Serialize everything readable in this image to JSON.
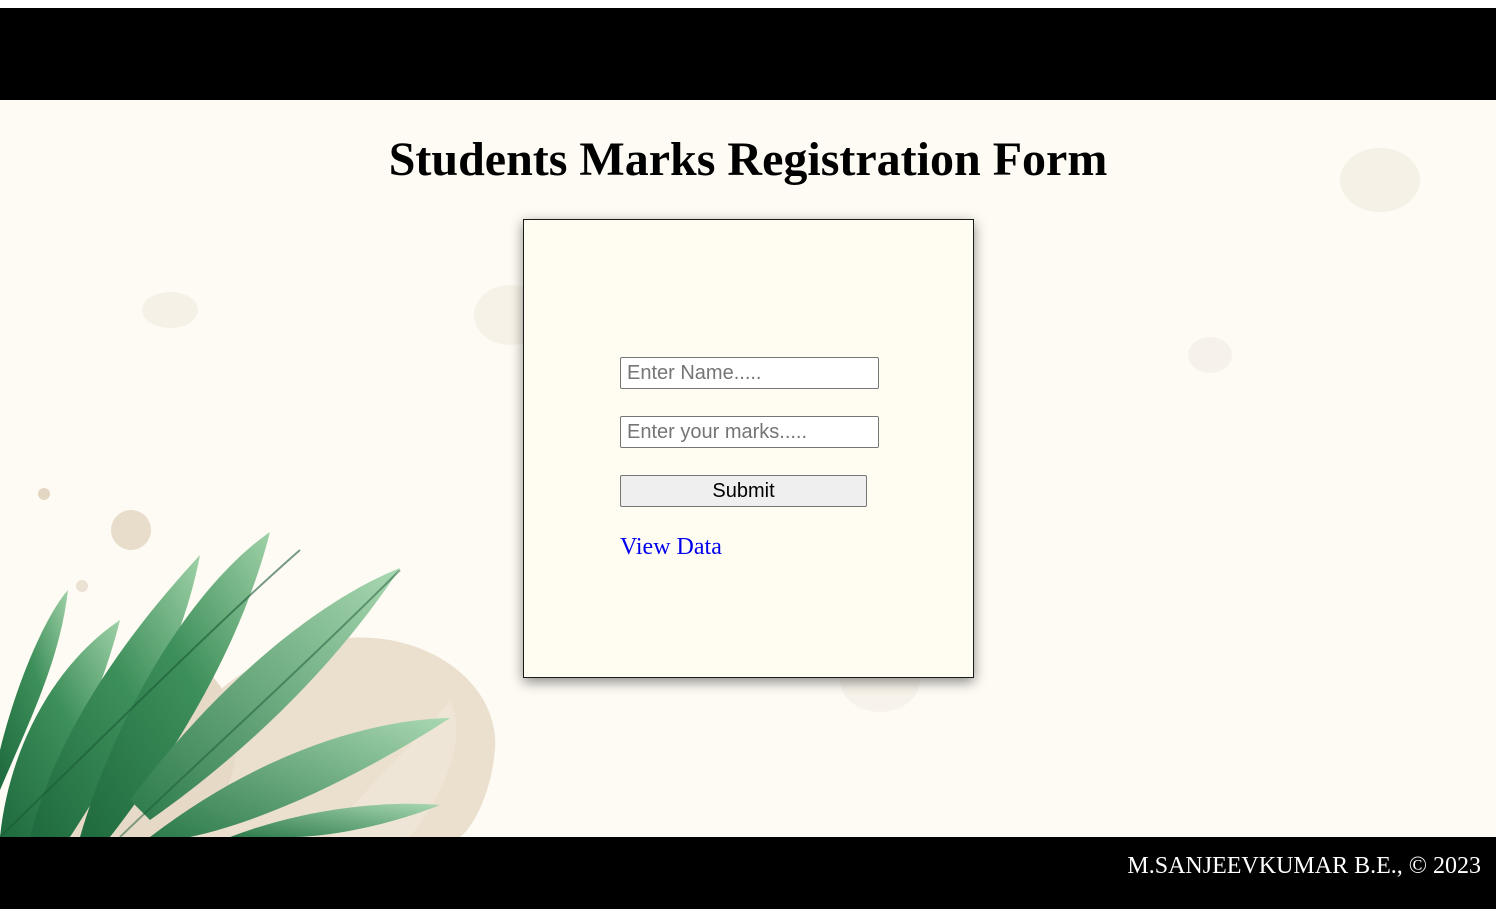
{
  "header": {
    "title": "Students Marks Registration Form"
  },
  "form": {
    "name_placeholder": "Enter Name.....",
    "marks_placeholder": "Enter your marks.....",
    "submit_label": "Submit",
    "view_link_label": "View Data"
  },
  "footer": {
    "text": "M.SANJEEVKUMAR B.E., © 2023"
  },
  "colors": {
    "background": "#fdfbf3",
    "bars": "#000000",
    "link": "#0000ee",
    "leaf_dark": "#2f7a4c",
    "leaf_light": "#8cc79a",
    "leaf_beige": "#e8dccb"
  },
  "icons": {
    "decoration": "leaf-decoration-icon"
  }
}
